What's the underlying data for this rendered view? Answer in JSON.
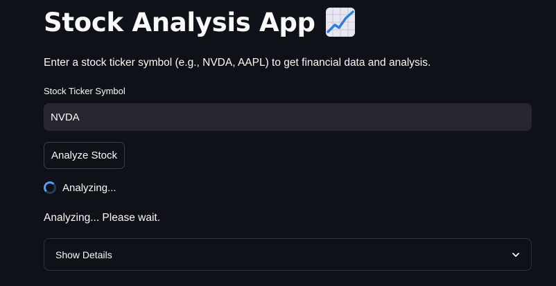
{
  "app": {
    "title": "Stock Analysis App",
    "title_icon": "chart-increasing-icon",
    "intro": "Enter a stock ticker symbol (e.g., NVDA, AAPL) to get financial data and analysis."
  },
  "ticker_field": {
    "label": "Stock Ticker Symbol",
    "value": "NVDA"
  },
  "analyze_button": {
    "label": "Analyze Stock"
  },
  "spinner": {
    "text": "Analyzing...",
    "icon": "spinner-icon"
  },
  "status": {
    "message": "Analyzing... Please wait."
  },
  "expander": {
    "label": "Show Details",
    "icon": "chevron-down-icon"
  },
  "colors": {
    "background": "#0e1117",
    "input_background": "#262730",
    "text": "#fafafa",
    "spinner_accent": "#4ea1ff"
  }
}
